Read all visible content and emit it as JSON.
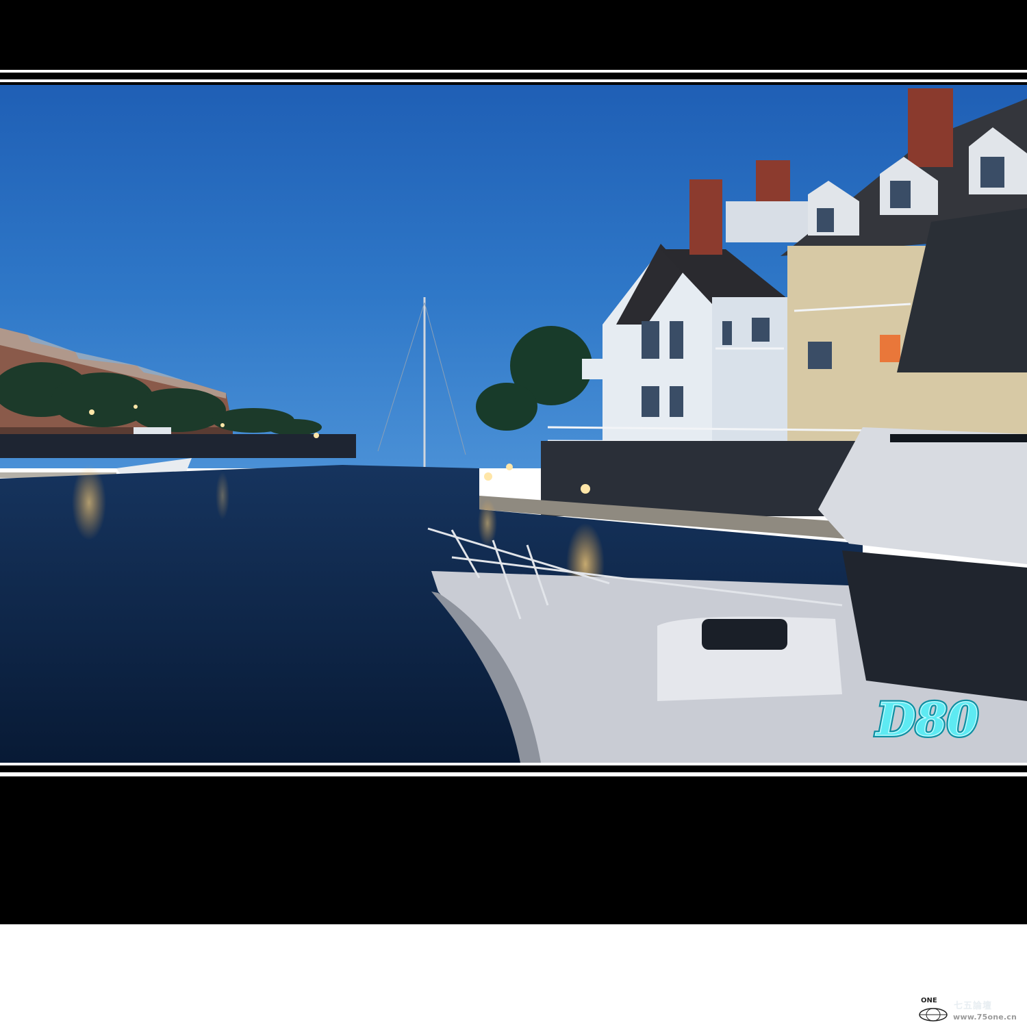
{
  "watermark": {
    "text": "D80"
  },
  "footer": {
    "brand_word": "ONE",
    "site_name": "七五論壇",
    "url": "www.75one.cn"
  },
  "colors": {
    "frame": "#000000",
    "sky_top": "#1f5fb5",
    "sky_bottom": "#3e8ad4",
    "water": "#0b2142",
    "watermark": "#3fe3ef"
  }
}
